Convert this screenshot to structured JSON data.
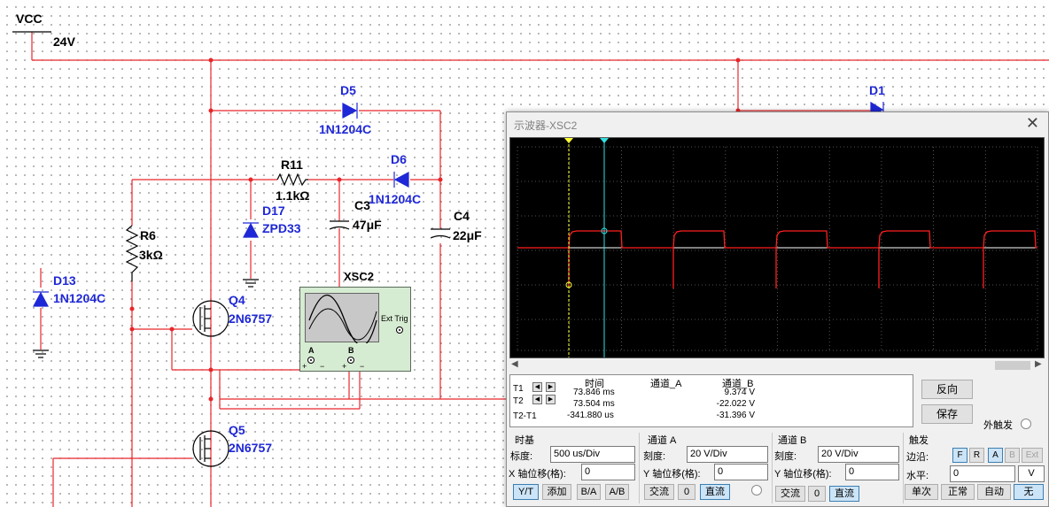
{
  "schematic": {
    "vcc_label": "VCC",
    "vcc_value": "24V",
    "components": [
      {
        "id": "D5",
        "name": "D5",
        "part": "1N1204C"
      },
      {
        "id": "D1",
        "name": "D1",
        "part": ""
      },
      {
        "id": "D6",
        "name": "D6",
        "part": "1N1204C"
      },
      {
        "id": "R11",
        "name": "R11",
        "part": "1.1kΩ"
      },
      {
        "id": "C3",
        "name": "C3",
        "part": "47μF"
      },
      {
        "id": "C4",
        "name": "C4",
        "part": "22μF"
      },
      {
        "id": "D17",
        "name": "D17",
        "part": "ZPD33"
      },
      {
        "id": "R6",
        "name": "R6",
        "part": "3kΩ"
      },
      {
        "id": "D13",
        "name": "D13",
        "part": "1N1204C"
      },
      {
        "id": "Q4",
        "name": "Q4",
        "part": "2N6757"
      },
      {
        "id": "Q5",
        "name": "Q5",
        "part": "2N6757"
      }
    ],
    "instrument": {
      "name": "XSC2",
      "ext_trig": "Ext Trig",
      "ch_a": "A",
      "ch_b": "B",
      "plus": "+",
      "minus": "−"
    },
    "colors": {
      "wire": "#e8262a",
      "part": "#1f28d6",
      "label": "#000000"
    }
  },
  "scope": {
    "title": "示波器-XSC2",
    "close_icon": "close-icon",
    "screen": {
      "background": "#000000",
      "trace_color": "#ff1f1f",
      "cursor1_color": "#ffff33",
      "cursor2_color": "#33e0e0",
      "baseline_color": "#ffffff",
      "grid_color": "#707070"
    },
    "readout": {
      "headers": {
        "time": "时间",
        "ch_a": "通道_A",
        "ch_b": "通道_B"
      },
      "rows": [
        {
          "label": "T1",
          "time": "73.846 ms",
          "ch_a": "",
          "ch_b": "9.374 V"
        },
        {
          "label": "T2",
          "time": "73.504 ms",
          "ch_a": "",
          "ch_b": "-22.022 V"
        },
        {
          "label": "T2-T1",
          "time": "-341.880 us",
          "ch_a": "",
          "ch_b": "-31.396 V"
        }
      ]
    },
    "buttons": {
      "reverse": "反向",
      "save": "保存",
      "ext_trigger": "外触发"
    },
    "timebase": {
      "title": "时基",
      "scale_label": "标度:",
      "scale": "500 us/Div",
      "x_offset_label": "X 轴位移(格):",
      "x_offset": "0",
      "modes": [
        "Y/T",
        "添加",
        "B/A",
        "A/B"
      ]
    },
    "channel_a": {
      "title": "通道 A",
      "scale_label": "刻度:",
      "scale": "20  V/Div",
      "y_offset_label": "Y 轴位移(格):",
      "y_offset": "0",
      "coupling": [
        "交流",
        "0",
        "直流"
      ]
    },
    "channel_b": {
      "title": "通道 B",
      "scale_label": "刻度:",
      "scale": "20  V/Div",
      "y_offset_label": "Y 轴位移(格):",
      "y_offset": "0",
      "coupling": [
        "交流",
        "0",
        "直流"
      ]
    },
    "trigger": {
      "title": "触发",
      "edge_label": "边沿:",
      "edge_buttons": [
        "F",
        "R",
        "A",
        "B",
        "Ext"
      ],
      "level_label": "水平:",
      "level": "0",
      "level_unit": "V",
      "modes": [
        "单次",
        "正常",
        "自动",
        "无"
      ]
    }
  }
}
